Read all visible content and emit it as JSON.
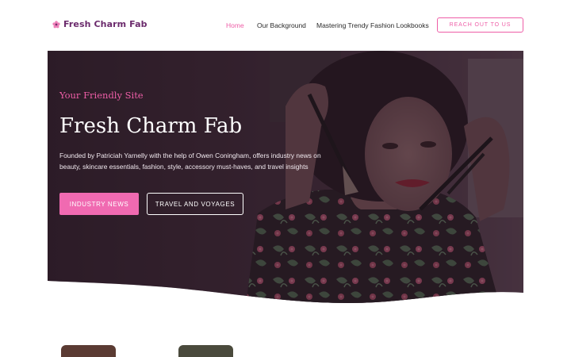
{
  "header": {
    "brand_name": "Fresh Charm Fab",
    "nav": [
      {
        "label": "Home",
        "active": true
      },
      {
        "label": "Our Background",
        "active": false
      },
      {
        "label": "Mastering Trendy Fashion Lookbooks",
        "active": false
      }
    ],
    "cta_label": "REACH OUT TO US"
  },
  "hero": {
    "eyebrow": "Your Friendly Site",
    "title": "Fresh Charm Fab",
    "description": "Founded by Patriciah Yarnelly with the help of Owen Coningham, offers industry news on beauty, skincare essentials, fashion, style, accessory must-haves, and travel insights",
    "primary_button": "INDUSTRY NEWS",
    "secondary_button": "TRAVEL AND VOYAGES",
    "image_icon": "woman-with-makeup-brushes-photo"
  },
  "colors": {
    "accent": "#ee5ea7",
    "brand": "#6b2a6c",
    "overlay": "#3a2233"
  }
}
